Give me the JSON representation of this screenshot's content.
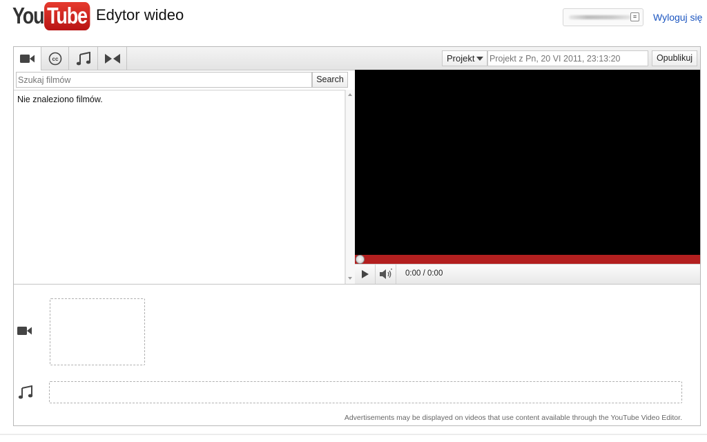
{
  "header": {
    "logo_you": "You",
    "logo_tube": "Tube",
    "title": "Edytor wideo",
    "signout": "Wyloguj się"
  },
  "toolbar": {
    "tabs": [
      {
        "name": "video",
        "icon": "video-camera-icon"
      },
      {
        "name": "captions",
        "icon": "cc-icon"
      },
      {
        "name": "audio",
        "icon": "music-note-icon"
      },
      {
        "name": "transitions",
        "icon": "transition-icon"
      }
    ],
    "project_label": "Projekt",
    "project_name": "Projekt z Pn, 20 VI 2011, 23:13:20",
    "publish_label": "Opublikuj"
  },
  "media": {
    "search_placeholder": "Szukaj filmów",
    "search_button": "Search",
    "empty_message": "Nie znaleziono filmów."
  },
  "player": {
    "time": "0:00 / 0:00",
    "progress": 0,
    "accent": "#b31f1f"
  },
  "timeline": {
    "ad_note": "Advertisements may be displayed on videos that use content available through the YouTube Video Editor."
  },
  "colors": {
    "brand_red": "#d71f1f",
    "link_blue": "#1b55c0"
  }
}
